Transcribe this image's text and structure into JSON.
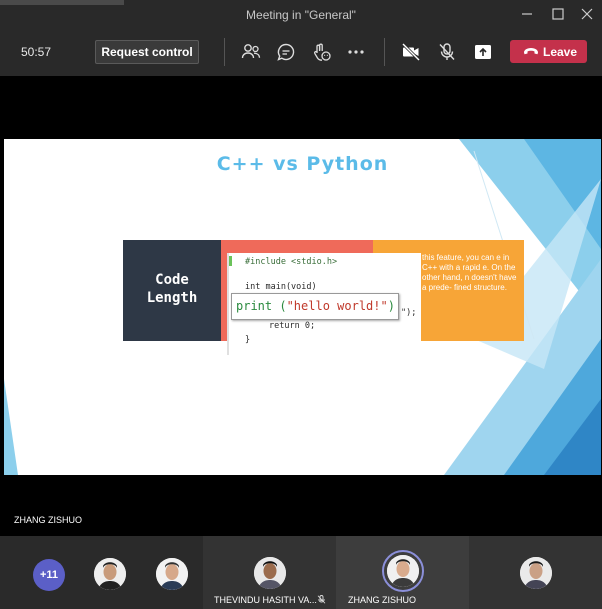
{
  "window": {
    "title": "Meeting in \"General\""
  },
  "toolbar": {
    "timer": "50:57",
    "request_control_label": "Request control",
    "leave_label": "Leave"
  },
  "slide": {
    "title": "C++ vs Python",
    "left_block_line1": "Code",
    "left_block_line2": "Length",
    "code_lines": [
      "#include <stdio.h>",
      "int main(void)",
      "\");",
      "return 0;",
      "}"
    ],
    "print_code": "print (",
    "print_string": "\"hello world!\"",
    "print_close": ")",
    "orange_text": "this feature, you can e in C++ with a rapid e. On the other hand, n doesn't have a prede- fined structure."
  },
  "presenter": {
    "name": "ZHANG ZISHUO"
  },
  "participants": {
    "more_count": "+11",
    "tile3_name": "THEVINDU HASITH VA...",
    "tile4_name": "ZHANG ZISHUO"
  }
}
